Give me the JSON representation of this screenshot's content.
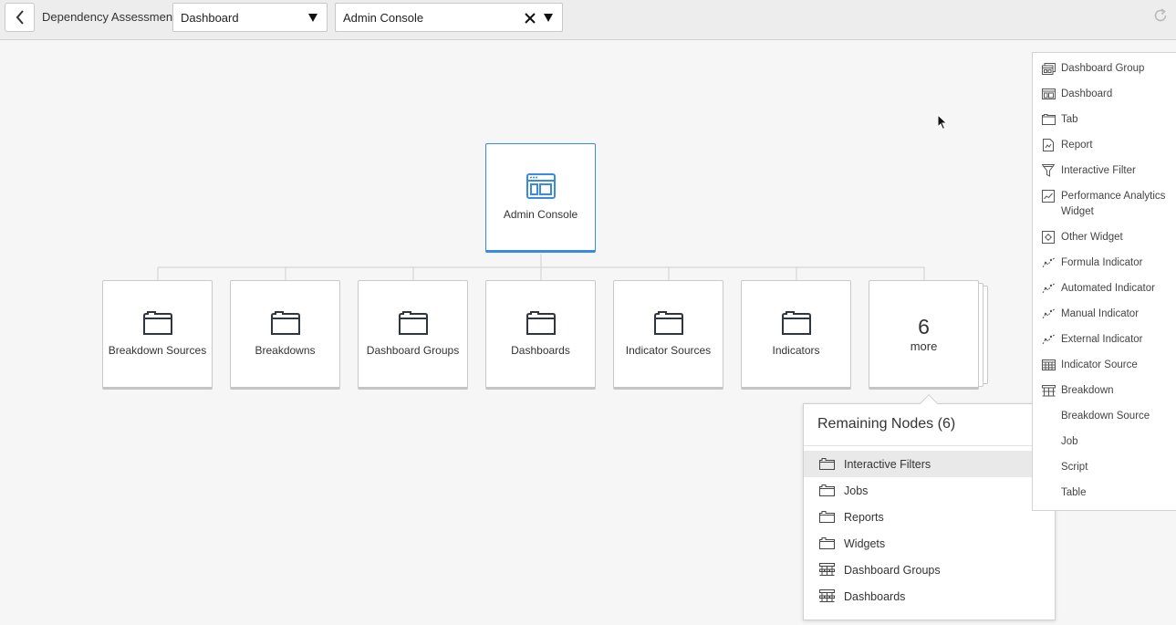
{
  "header": {
    "back_label": "Back",
    "title": "Dependency Assessment",
    "type_select": {
      "value": "Dashboard"
    },
    "item_select": {
      "value": "Admin Console"
    },
    "refresh_label": "Refresh"
  },
  "tree": {
    "root": {
      "label": "Admin Console",
      "icon": "dashboard-icon"
    },
    "children": [
      {
        "label": "Breakdown Sources",
        "icon": "folder-icon"
      },
      {
        "label": "Breakdowns",
        "icon": "folder-icon"
      },
      {
        "label": "Dashboard Groups",
        "icon": "folder-icon"
      },
      {
        "label": "Dashboards",
        "icon": "folder-icon"
      },
      {
        "label": "Indicator Sources",
        "icon": "folder-icon"
      },
      {
        "label": "Indicators",
        "icon": "folder-icon"
      }
    ],
    "more": {
      "count": "6",
      "label": "more"
    }
  },
  "remaining": {
    "title": "Remaining Nodes (6)",
    "items": [
      {
        "label": "Interactive Filters",
        "icon": "folder-icon",
        "active": true
      },
      {
        "label": "Jobs",
        "icon": "folder-icon"
      },
      {
        "label": "Reports",
        "icon": "folder-icon"
      },
      {
        "label": "Widgets",
        "icon": "folder-icon"
      },
      {
        "label": "Dashboard Groups",
        "icon": "breakdown-icon"
      },
      {
        "label": "Dashboards",
        "icon": "breakdown-icon"
      }
    ]
  },
  "legend": {
    "items": [
      {
        "label": "Dashboard Group",
        "icon": "dashboard-group-icon"
      },
      {
        "label": "Dashboard",
        "icon": "dashboard-icon"
      },
      {
        "label": "Tab",
        "icon": "tab-icon"
      },
      {
        "label": "Report",
        "icon": "report-icon"
      },
      {
        "label": "Interactive Filter",
        "icon": "filter-icon"
      },
      {
        "label": "Performance Analytics Widget",
        "icon": "chart-icon"
      },
      {
        "label": "Other Widget",
        "icon": "widget-icon"
      },
      {
        "label": "Formula Indicator",
        "icon": "indicator-icon"
      },
      {
        "label": "Automated Indicator",
        "icon": "indicator-icon"
      },
      {
        "label": "Manual Indicator",
        "icon": "indicator-icon"
      },
      {
        "label": "External Indicator",
        "icon": "indicator-icon"
      },
      {
        "label": "Indicator Source",
        "icon": "indicator-source-icon"
      },
      {
        "label": "Breakdown",
        "icon": "breakdown-icon"
      },
      {
        "label": "Breakdown Source",
        "icon": "breakdown-source-icon"
      },
      {
        "label": "Job",
        "icon": "job-icon"
      },
      {
        "label": "Script",
        "icon": "script-icon"
      },
      {
        "label": "Table",
        "icon": "table-icon"
      }
    ]
  },
  "colors": {
    "accent": "#3a8bdf",
    "icon_dark": "#2f3640",
    "background": "#f6f6f6"
  }
}
